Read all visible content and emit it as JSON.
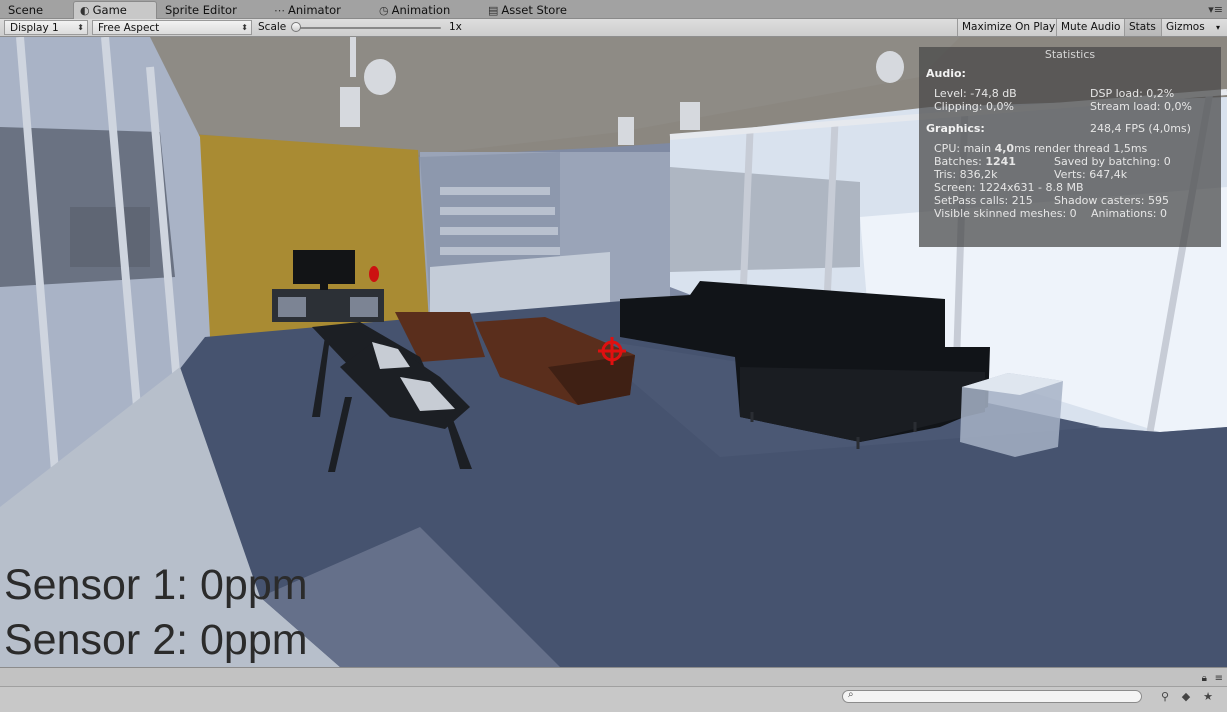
{
  "tabs": [
    {
      "label": "Scene",
      "icon": "scene-icon"
    },
    {
      "label": "Game",
      "icon": "game-icon",
      "active": true
    },
    {
      "label": "Sprite Editor",
      "icon": ""
    },
    {
      "label": "Animator",
      "icon": "animator-icon"
    },
    {
      "label": "Animation",
      "icon": "animation-icon"
    },
    {
      "label": "Asset Store",
      "icon": "asset-store-icon"
    }
  ],
  "toolbar": {
    "display": "Display 1",
    "aspect": "Free Aspect",
    "scale_label": "Scale",
    "scale_value": "1x",
    "scale_fraction": 0.0,
    "maximize": "Maximize On Play",
    "mute": "Mute Audio",
    "stats": "Stats",
    "gizmos": "Gizmos"
  },
  "stats": {
    "title": "Statistics",
    "audio_header": "Audio:",
    "level": "Level: -74,8 dB",
    "clipping": "Clipping: 0,0%",
    "dsp": "DSP load: 0,2%",
    "stream": "Stream load: 0,0%",
    "graphics_header": "Graphics:",
    "fps": "248,4 FPS (4,0ms)",
    "cpu_prefix": "CPU: main ",
    "cpu_main": "4,0",
    "cpu_suffix": "ms  render thread 1,5ms",
    "batches_prefix": "Batches: ",
    "batches": "1241",
    "saved": "Saved by batching: 0",
    "tris": "Tris: 836,2k",
    "verts": "Verts: 647,4k",
    "screen": "Screen: 1224x631 - 8.8 MB",
    "setpass": "SetPass calls: 215",
    "shadow": "Shadow casters: 595",
    "skinned": "Visible skinned meshes: 0",
    "animations": "Animations: 0"
  },
  "sensors": {
    "sensor1": "Sensor 1: 0ppm",
    "sensor2": "Sensor 2: 0ppm"
  },
  "colors": {
    "crosshair": "#e01010",
    "wall_accent": "#a98b33",
    "sofa": "#111418",
    "table": "#5a2e1c"
  }
}
